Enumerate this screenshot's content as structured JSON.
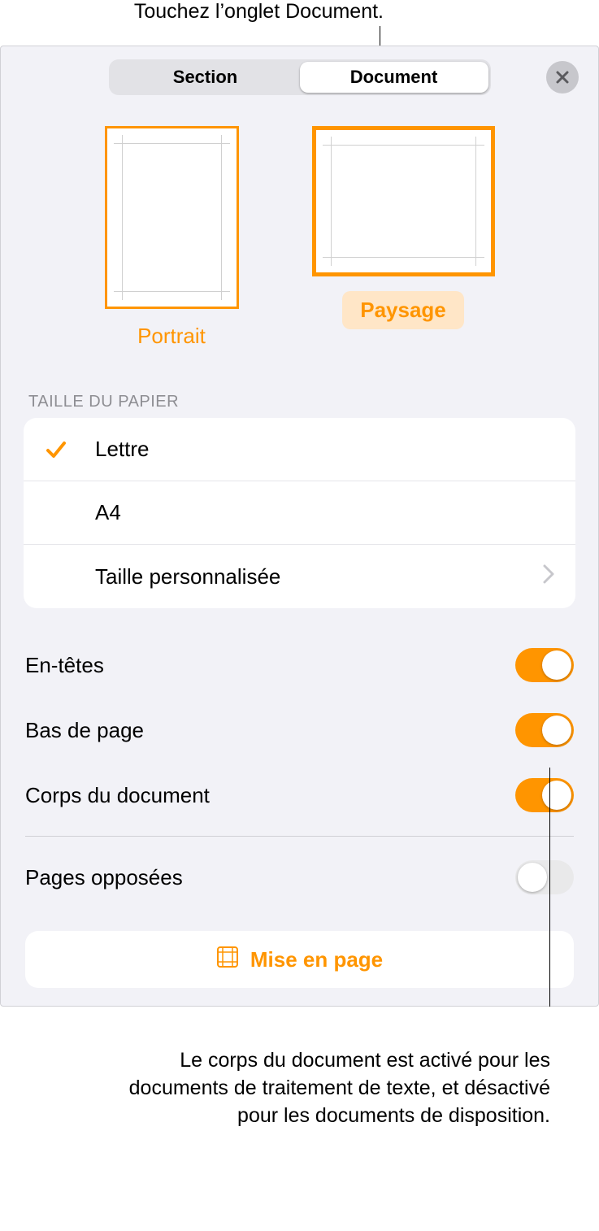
{
  "callouts": {
    "top": "Touchez l’onglet Document.",
    "bottom": "Le corps du document est activé pour les documents de traitement de texte, et désactivé pour les documents de disposition."
  },
  "tabs": {
    "section": "Section",
    "document": "Document"
  },
  "orientation": {
    "portrait": "Portrait",
    "landscape": "Paysage"
  },
  "paper": {
    "header": "TAILLE DU PAPIER",
    "letter": "Lettre",
    "a4": "A4",
    "custom": "Taille personnalisée"
  },
  "toggles": {
    "headers": "En-têtes",
    "footers": "Bas de page",
    "body": "Corps du document",
    "facing": "Pages opposées"
  },
  "button": {
    "layout": "Mise en page"
  },
  "icons": {
    "close": "close-icon",
    "check": "check-icon",
    "chevron": "chevron-right-icon",
    "layout": "layout-margins-icon"
  },
  "colors": {
    "accent": "#ff9500"
  }
}
